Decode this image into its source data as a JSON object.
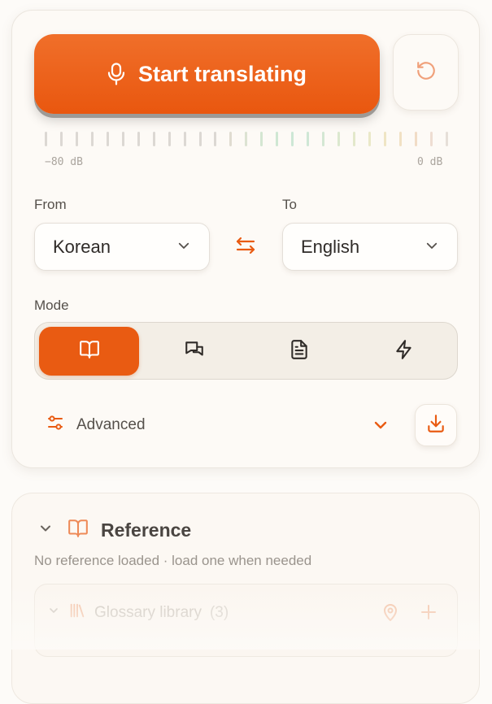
{
  "record": {
    "start_label": "Start translating",
    "db_min": "−80 dB",
    "db_max": "0 dB",
    "meter_colors": [
      "#dcd8d3",
      "#dcd8d3",
      "#dcd8d3",
      "#dcd8d3",
      "#dcd8d3",
      "#dcd8d3",
      "#dcd8d3",
      "#dcd8d3",
      "#dcd8d3",
      "#dcd8d3",
      "#dcd8d3",
      "#dcd8d3",
      "#e0dcd1",
      "#dce3d2",
      "#d4e6d2",
      "#cfe7d3",
      "#cde7d5",
      "#cfe7d5",
      "#d4e7d3",
      "#dbe8cf",
      "#e3e8cb",
      "#eae8c8",
      "#efe5c4",
      "#f1e1c4",
      "#f1dcc6",
      "#eeddd2",
      "#e6dfd8"
    ]
  },
  "languages": {
    "from_label": "From",
    "from_value": "Korean",
    "to_label": "To",
    "to_value": "English"
  },
  "mode": {
    "label": "Mode",
    "options": [
      "book-open-icon",
      "chat-bubbles-icon",
      "document-icon",
      "lightning-icon"
    ],
    "active_index": 0
  },
  "advanced": {
    "label": "Advanced"
  },
  "reference": {
    "title": "Reference",
    "subtitle": "No reference loaded · load one when needed",
    "glossary_label": "Glossary library",
    "glossary_count": "(3)"
  },
  "colors": {
    "accent": "#e95b12",
    "accent_light": "#f4a57c"
  }
}
